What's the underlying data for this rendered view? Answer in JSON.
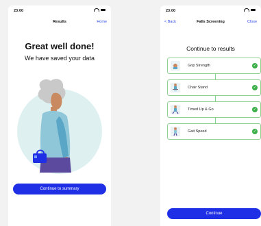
{
  "results_screen": {
    "status_time": "23:00",
    "status_dots": "...",
    "nav_title": "Results",
    "nav_right": "Home",
    "headline": "Great well done!",
    "subline": "We have saved your data",
    "cta": "Continue to summary"
  },
  "falls_screen": {
    "status_time": "23:00",
    "nav_left": "< Back",
    "nav_title": "Falls Screening",
    "nav_right": "Close",
    "section_title": "Continue to results",
    "tests": [
      {
        "label": "Grip Strength",
        "status": "completed",
        "icon": "hand-icon"
      },
      {
        "label": "Chair Stand",
        "status": "completed",
        "icon": "chair-stand-icon"
      },
      {
        "label": "Timed Up & Go",
        "status": "completed",
        "icon": "walking-icon"
      },
      {
        "label": "Gait Speed",
        "status": "completed",
        "icon": "gait-icon"
      }
    ],
    "cta": "Continue"
  },
  "colors": {
    "accent": "#1f2fe6",
    "success": "#3db04a",
    "card_border": "#8fd18f",
    "illustration_bg": "#def0f0"
  }
}
